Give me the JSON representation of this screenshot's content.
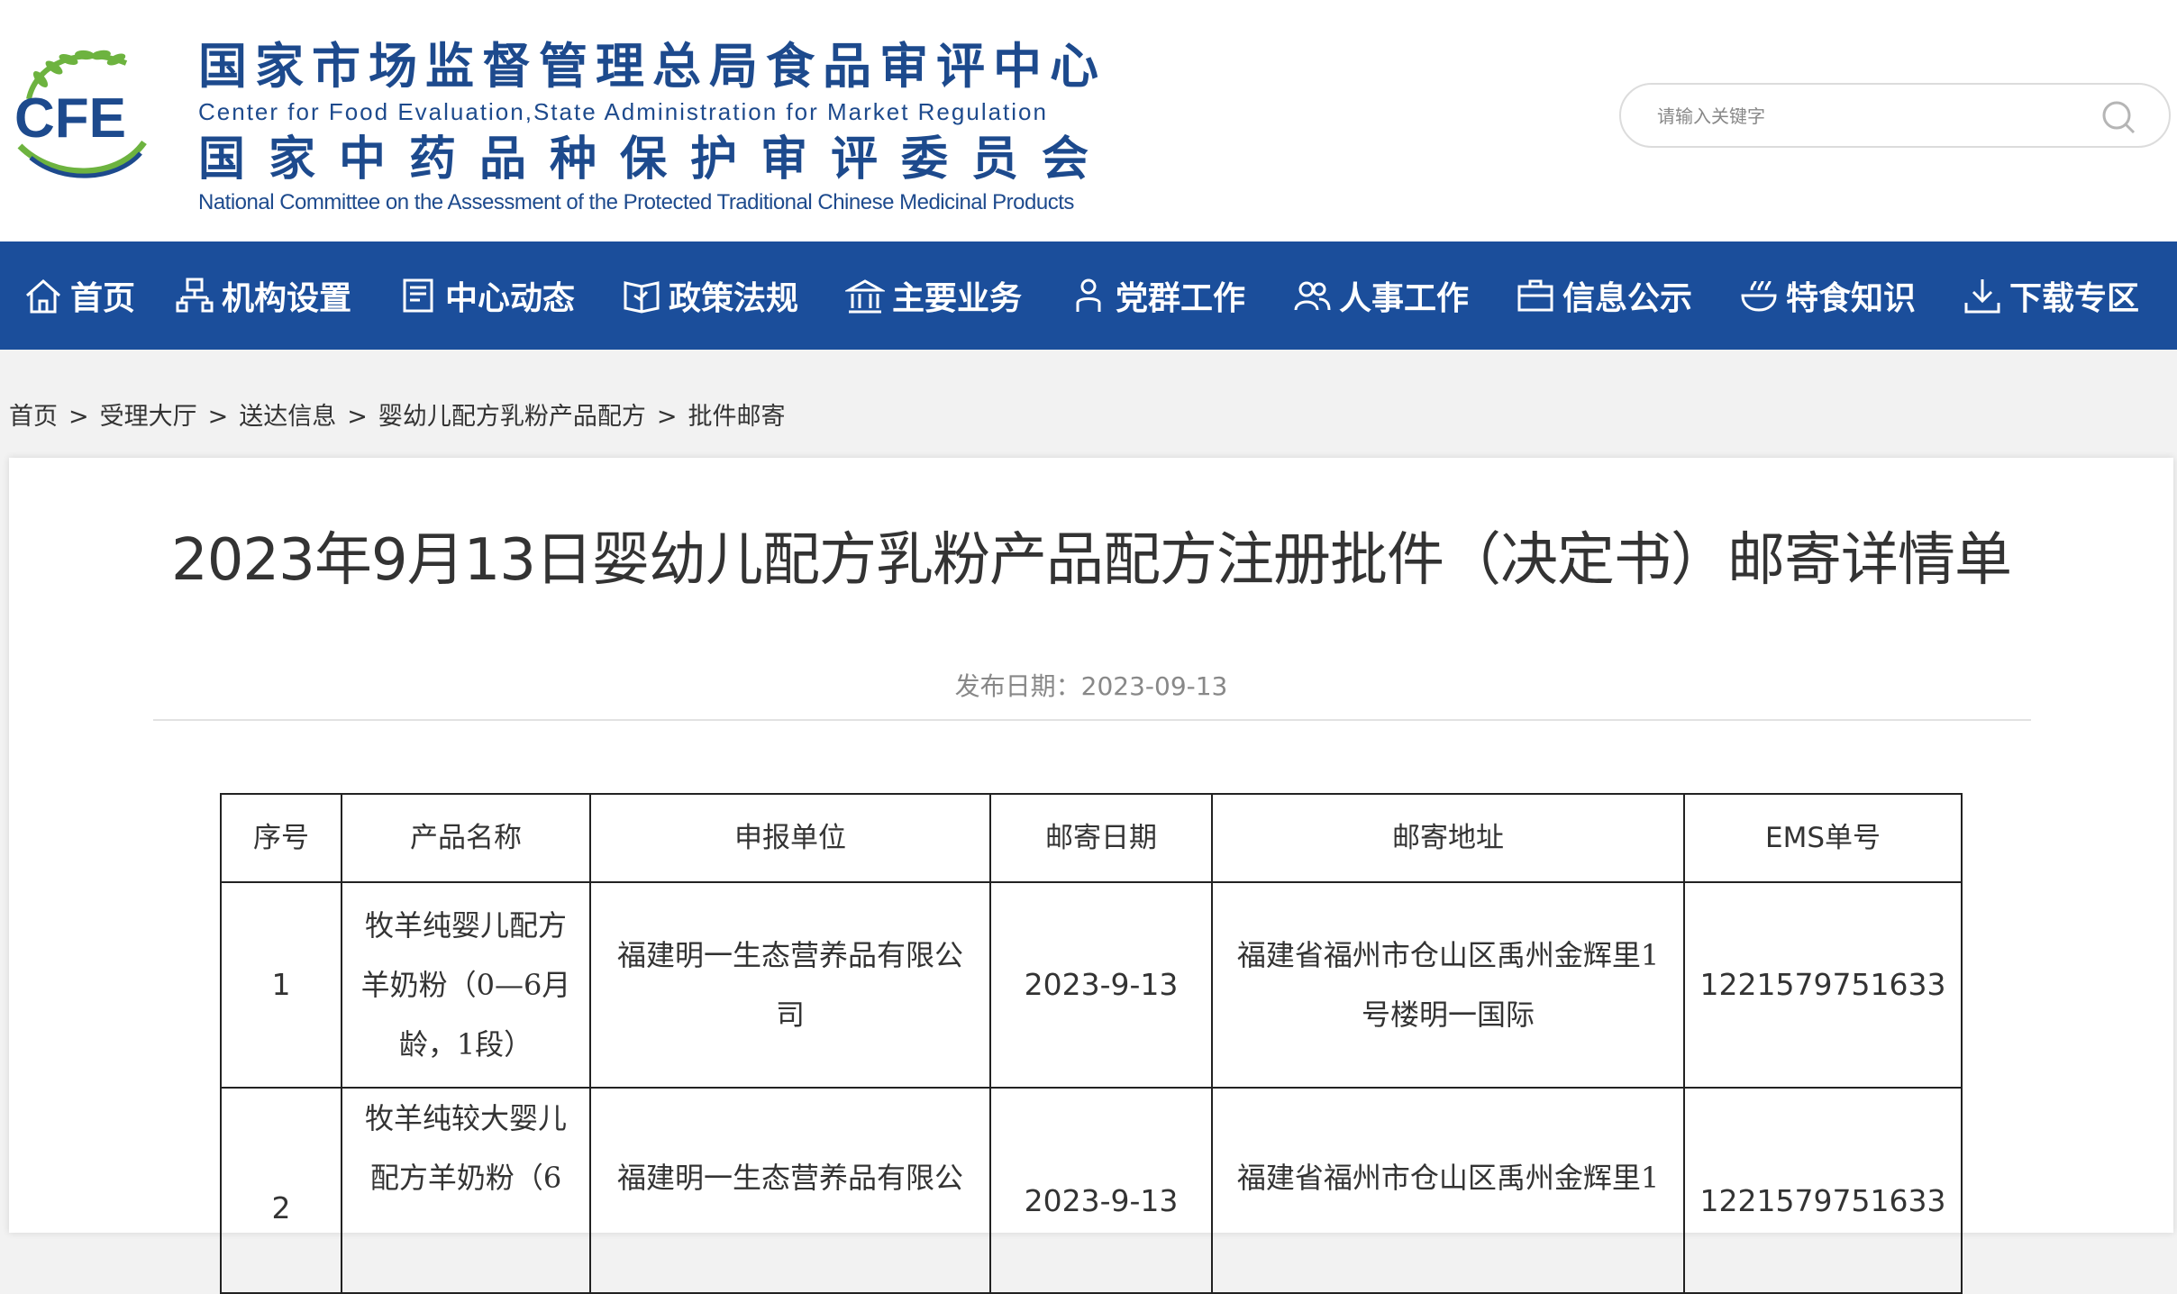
{
  "header": {
    "title_cn": "国家市场监督管理总局食品审评中心",
    "title_en": "Center for Food Evaluation,State Administration for Market Regulation",
    "subtitle_cn": "国家中药品种保护审评委员会",
    "subtitle_en": "National Committee on the Assessment of the Protected Traditional Chinese Medicinal Products",
    "logo_text": "CFE",
    "search_placeholder": "请输入关键字"
  },
  "nav": {
    "items": [
      {
        "label": "首页",
        "icon": "home-icon"
      },
      {
        "label": "机构设置",
        "icon": "org-chart-icon"
      },
      {
        "label": "中心动态",
        "icon": "news-icon"
      },
      {
        "label": "政策法规",
        "icon": "book-icon"
      },
      {
        "label": "主要业务",
        "icon": "building-icon"
      },
      {
        "label": "党群工作",
        "icon": "person-icon"
      },
      {
        "label": "人事工作",
        "icon": "people-icon"
      },
      {
        "label": "信息公示",
        "icon": "briefcase-icon"
      },
      {
        "label": "特食知识",
        "icon": "food-bowl-icon"
      },
      {
        "label": "下载专区",
        "icon": "download-icon"
      }
    ]
  },
  "breadcrumb": [
    "首页",
    "受理大厅",
    "送达信息",
    "婴幼儿配方乳粉产品配方",
    "批件邮寄"
  ],
  "breadcrumb_sep": ">",
  "article": {
    "title": "2023年9月13日婴幼儿配方乳粉产品配方注册批件（决定书）邮寄详情单",
    "pubdate_label": "发布日期：",
    "pubdate": "2023-09-13"
  },
  "table": {
    "headers": [
      "序号",
      "产品名称",
      "申报单位",
      "邮寄日期",
      "邮寄地址",
      "EMS单号"
    ],
    "rows": [
      {
        "seq": "1",
        "product": [
          "牧羊纯婴儿配方",
          "羊奶粉（0—6月",
          "龄，1段）"
        ],
        "company": [
          "福建明一生态营养品有限公",
          "司"
        ],
        "date": "2023-9-13",
        "address": [
          "福建省福州市仓山区禹州金辉里1",
          "号楼明一国际"
        ],
        "ems": "1221579751633"
      },
      {
        "seq": "2",
        "product": [
          "牧羊纯较大婴儿",
          "配方羊奶粉（6"
        ],
        "company": [
          "福建明一生态营养品有限公"
        ],
        "date": "2023-9-13",
        "address": [
          "福建省福州市仓山区禹州金辉里1"
        ],
        "ems": "1221579751633"
      }
    ]
  },
  "colors": {
    "nav_bg": "#1b4e9b",
    "brand_blue": "#1d4a8d",
    "logo_green": "#6db33f"
  }
}
